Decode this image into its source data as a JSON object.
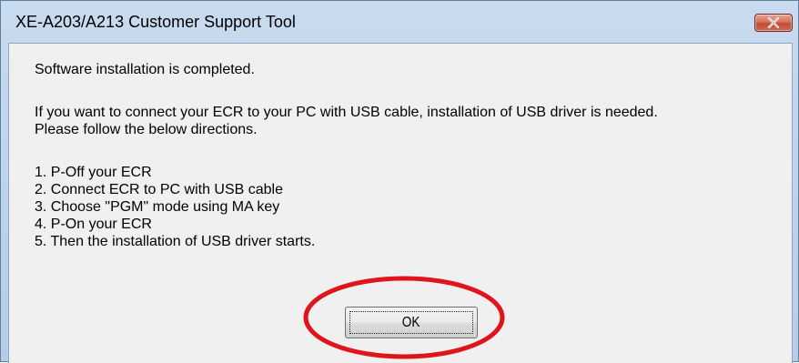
{
  "window": {
    "title": "XE-A203/A213 Customer Support Tool",
    "close_glyph": "✕"
  },
  "message": {
    "line1": "Software installation is completed.",
    "line2": "If you want to connect your ECR to your PC with USB cable, installation of USB driver is needed.",
    "line3": "Please follow the below directions.",
    "steps": [
      "1. P-Off your ECR",
      "2. Connect ECR to PC with USB cable",
      "3. Choose \"PGM\" mode using MA key",
      "4. P-On your ECR",
      "5. Then the installation of USB driver starts."
    ]
  },
  "buttons": {
    "ok_label": "OK"
  },
  "colors": {
    "annotation_circle": "#e0141b",
    "close_button": "#c24a33"
  }
}
